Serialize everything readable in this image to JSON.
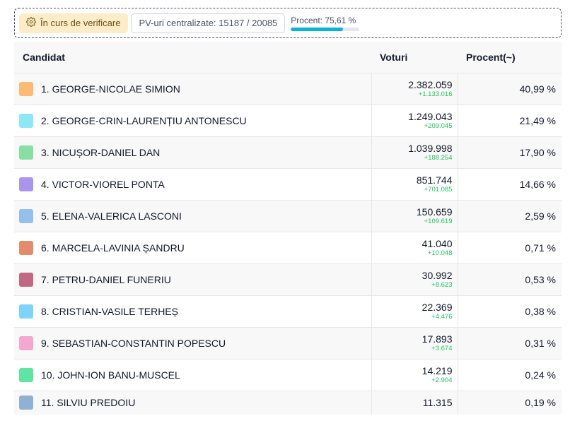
{
  "status": {
    "verification_label": "În curs de verificare",
    "pv_label": "PV-uri centralizate: 15187 / 20085",
    "progress_label": "Procent: 75,61 %",
    "progress_fraction": 0.7561,
    "progress_color": "#06b6d4"
  },
  "table": {
    "headers": {
      "candidate": "Candidat",
      "votes": "Voturi",
      "percent": "Procent(~)"
    },
    "rows": [
      {
        "name": "1. GEORGE-NICOLAE SIMION",
        "votes": "2.382.059",
        "delta": "+1.133.016",
        "percent": "40,99 %",
        "color": "#fdba74"
      },
      {
        "name": "2. GEORGE-CRIN-LAURENȚIU ANTONESCU",
        "votes": "1.249.043",
        "delta": "+209.045",
        "percent": "21,49 %",
        "color": "#8ee8f4"
      },
      {
        "name": "3. NICUȘOR-DANIEL DAN",
        "votes": "1.039.998",
        "delta": "+188.254",
        "percent": "17,90 %",
        "color": "#86e0a0"
      },
      {
        "name": "4. VICTOR-VIOREL PONTA",
        "votes": "851.744",
        "delta": "+701.085",
        "percent": "14,66 %",
        "color": "#a995ee"
      },
      {
        "name": "5. ELENA-VALERICA LASCONI",
        "votes": "150.659",
        "delta": "+109.619",
        "percent": "2,59 %",
        "color": "#93c0ee"
      },
      {
        "name": "6. MARCELA-LAVINIA ȘANDRU",
        "votes": "41.040",
        "delta": "+10.048",
        "percent": "0,71 %",
        "color": "#e58b6c"
      },
      {
        "name": "7. PETRU-DANIEL FUNERIU",
        "votes": "30.992",
        "delta": "+8.623",
        "percent": "0,53 %",
        "color": "#c26884"
      },
      {
        "name": "8. CRISTIAN-VASILE TERHEȘ",
        "votes": "22.369",
        "delta": "+4.476",
        "percent": "0,38 %",
        "color": "#7cd4fa"
      },
      {
        "name": "9. SEBASTIAN-CONSTANTIN POPESCU",
        "votes": "17.893",
        "delta": "+3.674",
        "percent": "0,31 %",
        "color": "#f4a7cf"
      },
      {
        "name": "10. JOHN-ION BANU-MUSCEL",
        "votes": "14.219",
        "delta": "+2.904",
        "percent": "0,24 %",
        "color": "#5ee59e"
      },
      {
        "name": "11. SILVIU PREDOIU",
        "votes": "11.315",
        "delta": "",
        "percent": "0,19 %",
        "color": "#8eb1d4"
      }
    ]
  }
}
